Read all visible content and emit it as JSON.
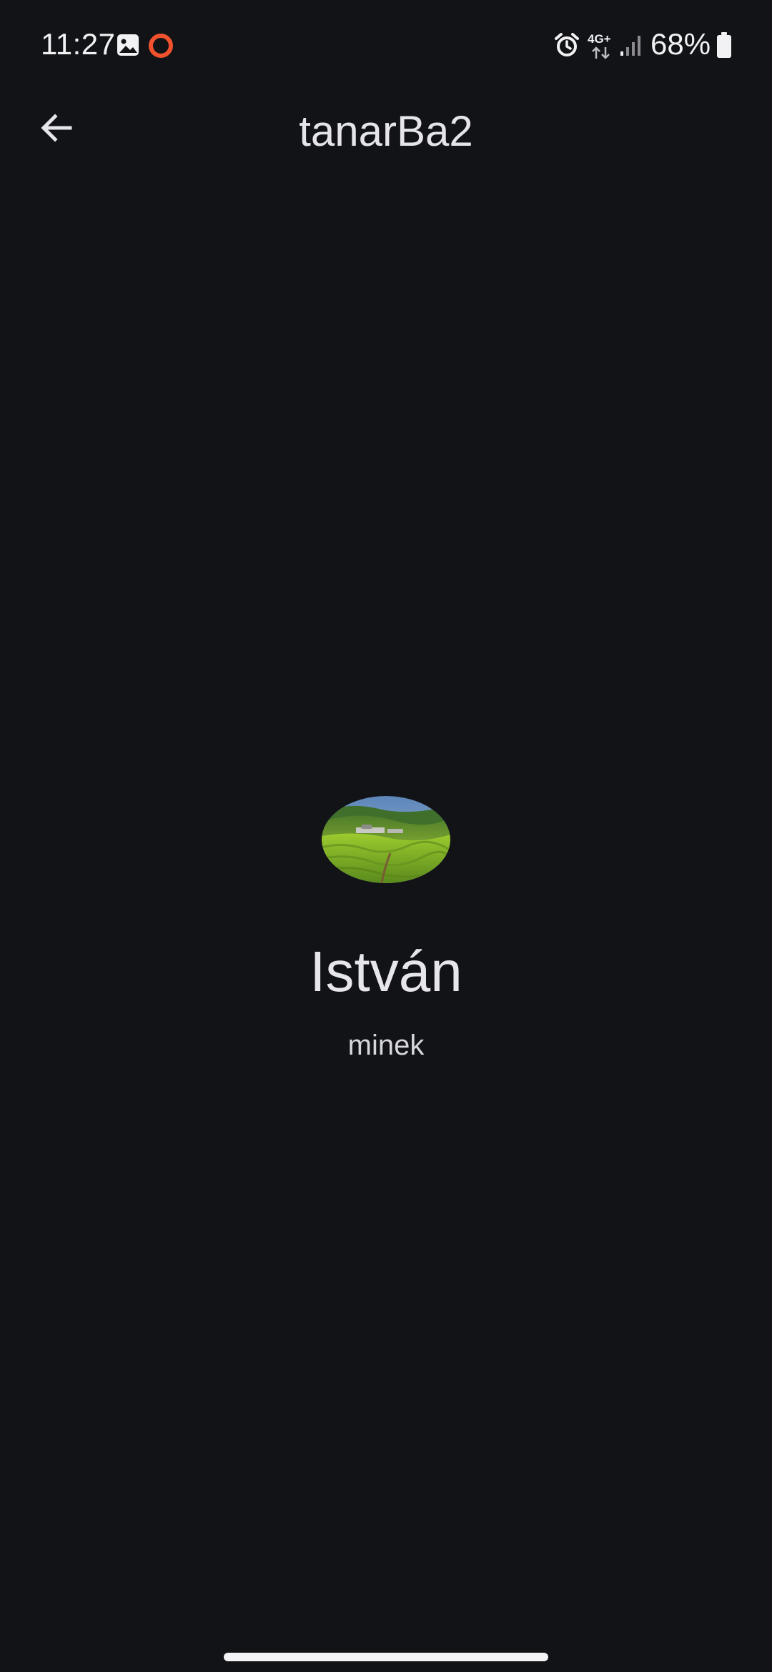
{
  "status_bar": {
    "time": "11:27",
    "network": "4G+",
    "battery": "68%",
    "icons": [
      "gallery-icon",
      "recording-indicator-icon",
      "alarm-icon",
      "network-data-icon",
      "signal-icon",
      "battery-icon"
    ],
    "recording_color": "#f0522d"
  },
  "app_bar": {
    "title": "tanarBa2",
    "back_icon": "arrow-back-icon"
  },
  "profile": {
    "name": "István",
    "subtitle": "minek",
    "image": "tea-plantation-landscape"
  },
  "colors": {
    "background": "#121317",
    "text": "#e6e6ec"
  }
}
